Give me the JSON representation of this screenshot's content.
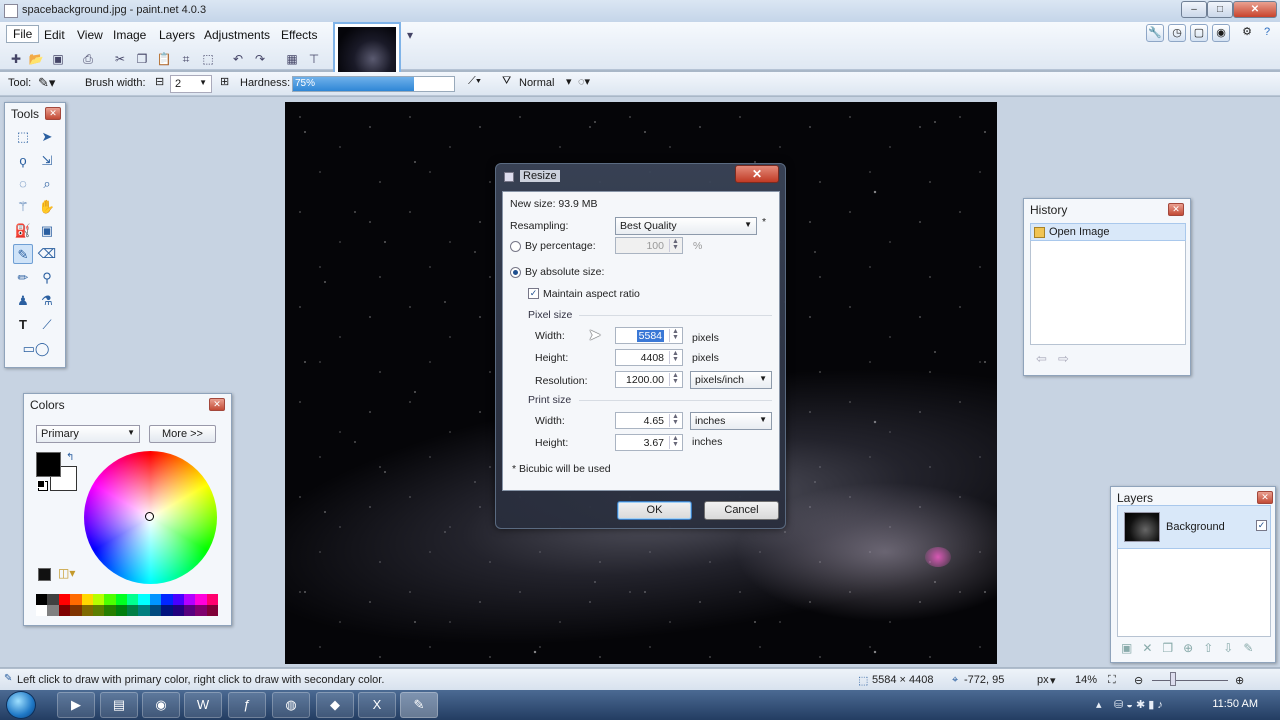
{
  "app": {
    "title": "spacebackground.jpg - paint.net 4.0.3"
  },
  "menu": {
    "items": [
      "File",
      "Edit",
      "View",
      "Image",
      "Layers",
      "Adjustments",
      "Effects"
    ]
  },
  "toolbar": {
    "tool_label": "Tool:",
    "brush_width_label": "Brush width:",
    "brush_width_value": "2",
    "hardness_label": "Hardness:",
    "hardness_value": "75%",
    "hardness_level": 0.75,
    "blend_mode": "Normal"
  },
  "tools_panel": {
    "title": "Tools",
    "icons": [
      "rectangle-select-icon",
      "move-selection-icon",
      "lasso-icon",
      "move-selected-icon",
      "ellipse-select-icon",
      "zoom-icon",
      "magic-wand-icon",
      "pan-icon",
      "paint-bucket-icon",
      "gradient-icon",
      "paintbrush-icon",
      "eraser-icon",
      "pencil-icon",
      "color-picker-icon",
      "clone-stamp-icon",
      "recolor-icon",
      "text-icon",
      "line-curve-icon",
      "shapes-icon"
    ]
  },
  "colors_panel": {
    "title": "Colors",
    "mode": "Primary",
    "more_button": "More >>",
    "primary_color": "#000000",
    "secondary_color": "#ffffff",
    "palette": [
      "#000000",
      "#404040",
      "#ff0000",
      "#ff6a00",
      "#ffd800",
      "#b6ff00",
      "#4cff00",
      "#00ff21",
      "#00ff90",
      "#00ffff",
      "#0094ff",
      "#0026ff",
      "#4800ff",
      "#b200ff",
      "#ff00dc",
      "#ff006e",
      "#ffffff",
      "#808080",
      "#7f0000",
      "#7f3300",
      "#7f6a00",
      "#5b7f00",
      "#267f00",
      "#007f0e",
      "#007f46",
      "#007f7f",
      "#004a7f",
      "#00137f",
      "#21007f",
      "#57007f",
      "#7f006e",
      "#7f0037"
    ]
  },
  "dialog": {
    "title": "Resize",
    "new_size": "New size: 93.9 MB",
    "resampling_label": "Resampling:",
    "resampling_value": "Best Quality",
    "resampling_note": "*",
    "by_percentage_label": "By percentage:",
    "percentage_value": "100",
    "percent_unit": "%",
    "by_absolute_label": "By absolute size:",
    "maintain_aspect_label": "Maintain aspect ratio",
    "pixel_size_label": "Pixel size",
    "width_label": "Width:",
    "width_value": "5584",
    "height_label": "Height:",
    "height_value": "4408",
    "pixels_unit": "pixels",
    "resolution_label": "Resolution:",
    "resolution_value": "1200.00",
    "resolution_unit": "pixels/inch",
    "print_size_label": "Print size",
    "print_width_value": "4.65",
    "print_width_unit": "inches",
    "print_height_value": "3.67",
    "print_height_unit": "inches",
    "footnote": "* Bicubic will be used",
    "ok_button": "OK",
    "cancel_button": "Cancel"
  },
  "history_panel": {
    "title": "History",
    "items": [
      "Open Image"
    ]
  },
  "layers_panel": {
    "title": "Layers",
    "layers": [
      {
        "name": "Background",
        "visible": true
      }
    ]
  },
  "status": {
    "hint": "Left click to draw with primary color, right click to draw with secondary color.",
    "image_size": "5584 × 4408",
    "cursor_pos": "-772, 95",
    "unit": "px",
    "zoom": "14%"
  },
  "taskbar": {
    "time": "11:50 AM"
  }
}
